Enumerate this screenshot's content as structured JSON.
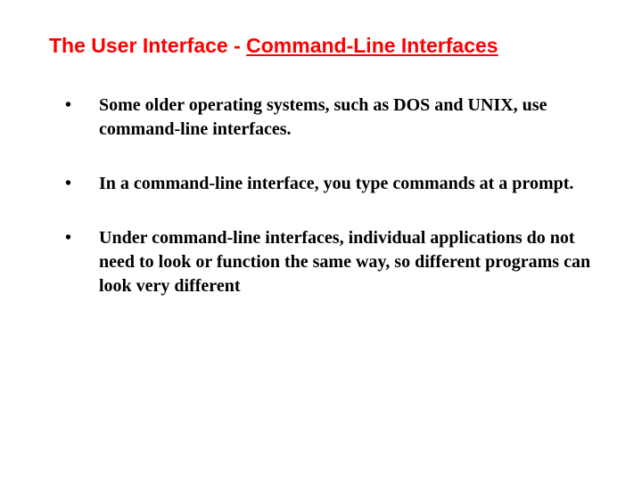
{
  "title": {
    "prefix": "The User Interface - ",
    "underlined": "Command-Line Interfaces"
  },
  "bullets": [
    "Some older operating systems, such as DOS and UNIX, use command-line interfaces.",
    "In a command-line interface, you type commands at a prompt.",
    "Under command-line interfaces, individual applications do not need to look or function the same way, so different programs can look very different"
  ]
}
